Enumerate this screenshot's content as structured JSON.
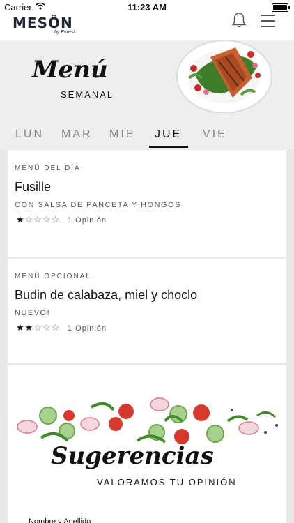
{
  "status_bar": {
    "carrier": "Carrier",
    "time": "11:23 AM"
  },
  "header": {
    "brand": "MESÔN",
    "brand_sub": "by Evrest"
  },
  "hero": {
    "title": "Menú",
    "subtitle": "SEMANAL"
  },
  "days": [
    {
      "label": "LUN",
      "active": false
    },
    {
      "label": "MAR",
      "active": false
    },
    {
      "label": "MIE",
      "active": false
    },
    {
      "label": "JUE",
      "active": true
    },
    {
      "label": "VIE",
      "active": false
    }
  ],
  "menu_items": [
    {
      "section": "MENÚ DEL DÍA",
      "dish": "Fusille",
      "description": "CON SALSA DE PANCETA Y HONGOS",
      "rating": 1,
      "max_rating": 5,
      "opinions": "1 Opinión"
    },
    {
      "section": "MENÚ OPCIONAL",
      "dish": "Budin de calabaza, miel y choclo",
      "description": "NUEVO!",
      "rating": 2,
      "max_rating": 5,
      "opinions": "1 Opinión"
    }
  ],
  "suggestions": {
    "title": "Sugerencias",
    "subtitle": "VALORAMOS TU OPINIÓN",
    "field_label": "Nombre y Apellido"
  },
  "icons": {
    "bell": "bell-icon",
    "menu": "hamburger-menu-icon",
    "star_full": "★",
    "star_empty": "☆"
  },
  "colors": {
    "brand": "#1e2a38",
    "background": "#e9e9e9",
    "accent": "#111111"
  }
}
